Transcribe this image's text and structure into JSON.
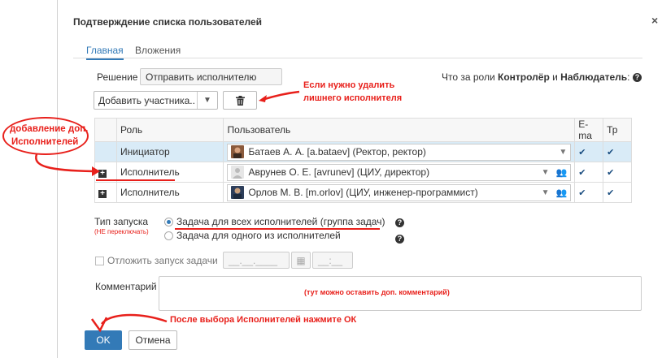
{
  "dialog": {
    "title": "Подтверждение списка пользователей",
    "close": "×"
  },
  "tabs": [
    {
      "label": "Главная",
      "active": true
    },
    {
      "label": "Вложения",
      "active": false
    }
  ],
  "decision": {
    "label": "Решение",
    "value": "Отправить исполнителю"
  },
  "roles_help": {
    "prefix": "Что за роли ",
    "role1": "Контролёр",
    "mid": " и ",
    "role2": "Наблюдатель",
    "suffix": ":"
  },
  "toolbar": {
    "add_participant": "Добавить участника..",
    "delete_icon": "trash-icon"
  },
  "table": {
    "headers": {
      "role": "Роль",
      "user": "Пользователь",
      "email": "E-ma",
      "tp": "Тр"
    },
    "rows": [
      {
        "role": "Инициатор",
        "user": "Батаев А. А. [a.bataev] (Ректор, ректор)",
        "email": "✔",
        "tp": "✔"
      },
      {
        "role": "Исполнитель",
        "user": "Аврунев О. Е. [avrunev] (ЦИУ, директор)",
        "email": "✔",
        "tp": "✔"
      },
      {
        "role": "Исполнитель",
        "user": "Орлов М. В. [m.orlov] (ЦИУ, инженер-программист)",
        "email": "✔",
        "tp": "✔"
      }
    ]
  },
  "launch": {
    "label": "Тип запуска",
    "note": "(НЕ переключать)",
    "option1": "Задача для всех исполнителей (группа задач)",
    "option2": "Задача для одного из исполнителей",
    "selected": 1
  },
  "postpone": {
    "label": "Отложить запуск задачи",
    "date_placeholder": "__.__.____",
    "time_placeholder": "__:__"
  },
  "comment": {
    "label": "Комментарий",
    "hint": "(тут можно оставить доп. комментарий)"
  },
  "buttons": {
    "ok": "OK",
    "cancel": "Отмена"
  },
  "annotations": {
    "delete_hint_line1": "Если нужно удалить",
    "delete_hint_line2": "лишнего исполнителя",
    "add_hint_line1": "добавление доп.",
    "add_hint_line2": "Исполнителей",
    "ok_hint": "После выбора Исполнителей нажмите ОК"
  },
  "colors": {
    "accent": "#337ab7",
    "annotation": "#e8201b",
    "selected_row": "#d9ebf7"
  }
}
